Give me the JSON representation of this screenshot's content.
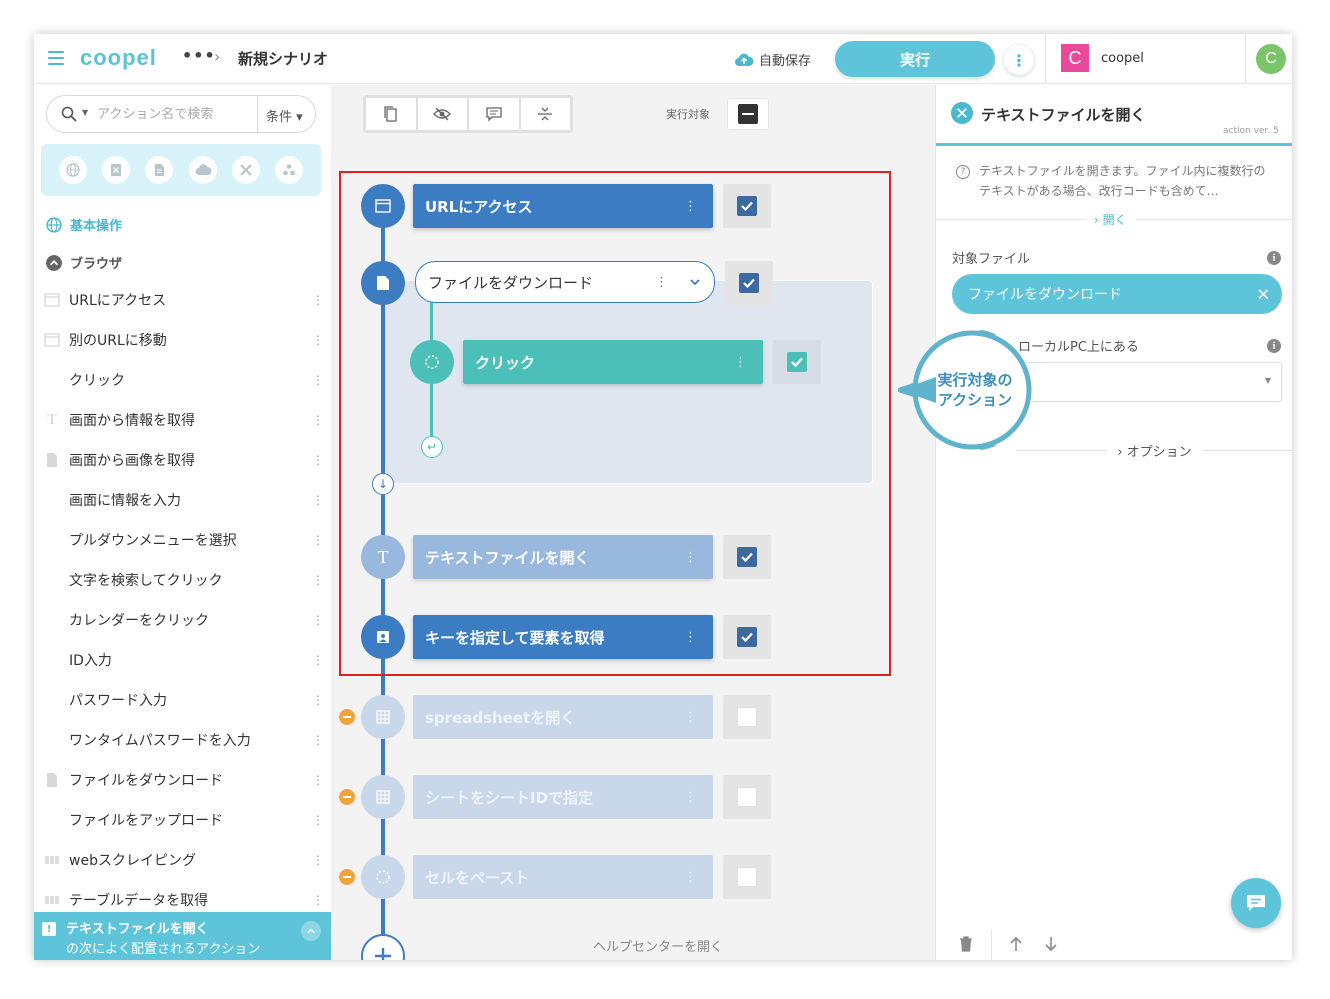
{
  "header": {
    "logo": "coopel",
    "more": "•••",
    "breadcrumb_sep": "›",
    "scenario_title": "新規シナリオ",
    "autosave_label": "自動保存",
    "run_label": "実行",
    "more_menu": "⋮",
    "workspace_initial": "C",
    "workspace_name": "coopel",
    "user_initial": "C",
    "colors": {
      "accent": "#5ec4da",
      "workspace_badge": "#e8499a",
      "user_avatar": "#7cc46a"
    }
  },
  "sidebar": {
    "search_placeholder": "アクション名で検索",
    "condition_label": "条件 ▾",
    "category_icons": [
      "globe-icon",
      "excel-icon",
      "document-icon",
      "cloud-icon",
      "tools-icon",
      "apps-icon"
    ],
    "group_basic": "基本操作",
    "group_browser": "ブラウザ",
    "items": [
      {
        "label": "URLにアクセス",
        "icon": "window-icon"
      },
      {
        "label": "別のURLに移動",
        "icon": "window-icon"
      },
      {
        "label": "クリック",
        "icon": ""
      },
      {
        "label": "画面から情報を取得",
        "icon": "text-icon"
      },
      {
        "label": "画面から画像を取得",
        "icon": "document-icon"
      },
      {
        "label": "画面に情報を入力",
        "icon": ""
      },
      {
        "label": "プルダウンメニューを選択",
        "icon": ""
      },
      {
        "label": "文字を検索してクリック",
        "icon": ""
      },
      {
        "label": "カレンダーをクリック",
        "icon": ""
      },
      {
        "label": "ID入力",
        "icon": ""
      },
      {
        "label": "パスワード入力",
        "icon": ""
      },
      {
        "label": "ワンタイムパスワードを入力",
        "icon": ""
      },
      {
        "label": "ファイルをダウンロード",
        "icon": "document-icon"
      },
      {
        "label": "ファイルをアップロード",
        "icon": ""
      },
      {
        "label": "webスクレイピング",
        "icon": "table-icon"
      },
      {
        "label": "テーブルデータを取得",
        "icon": "table-icon"
      }
    ],
    "suggest_title": "テキストファイルを開く",
    "suggest_sub": "の次によく配置されるアクション"
  },
  "canvas": {
    "target_label": "実行対象",
    "actions": [
      {
        "label": "URLにアクセス",
        "checked": true
      },
      {
        "label": "ファイルをダウンロード",
        "checked": true
      },
      {
        "label": "クリック",
        "checked": true
      },
      {
        "label": "テキストファイルを開く",
        "checked": true
      },
      {
        "label": "キーを指定して要素を取得",
        "checked": true
      },
      {
        "label": "spreadsheetを開く",
        "checked": false
      },
      {
        "label": "シートをシートIDで指定",
        "checked": false
      },
      {
        "label": "セルをペースト",
        "checked": false
      }
    ],
    "menu_glyph": "⋮",
    "help_link": "ヘルプセンターを開く",
    "callout": "実行対象の\nアクション"
  },
  "panel": {
    "title": "テキストファイルを開く",
    "version": "action ver. 5",
    "description": "テキストファイルを開きます。ファイル内に複数行のテキストがある場合、改行コードも含めて…",
    "expand_label": "› 開く",
    "target_file_label": "対象ファイル",
    "target_file_value": "ファイルをダウンロード",
    "local_pc_label": "ローカルPC上にある",
    "option_label": "› オプション"
  }
}
